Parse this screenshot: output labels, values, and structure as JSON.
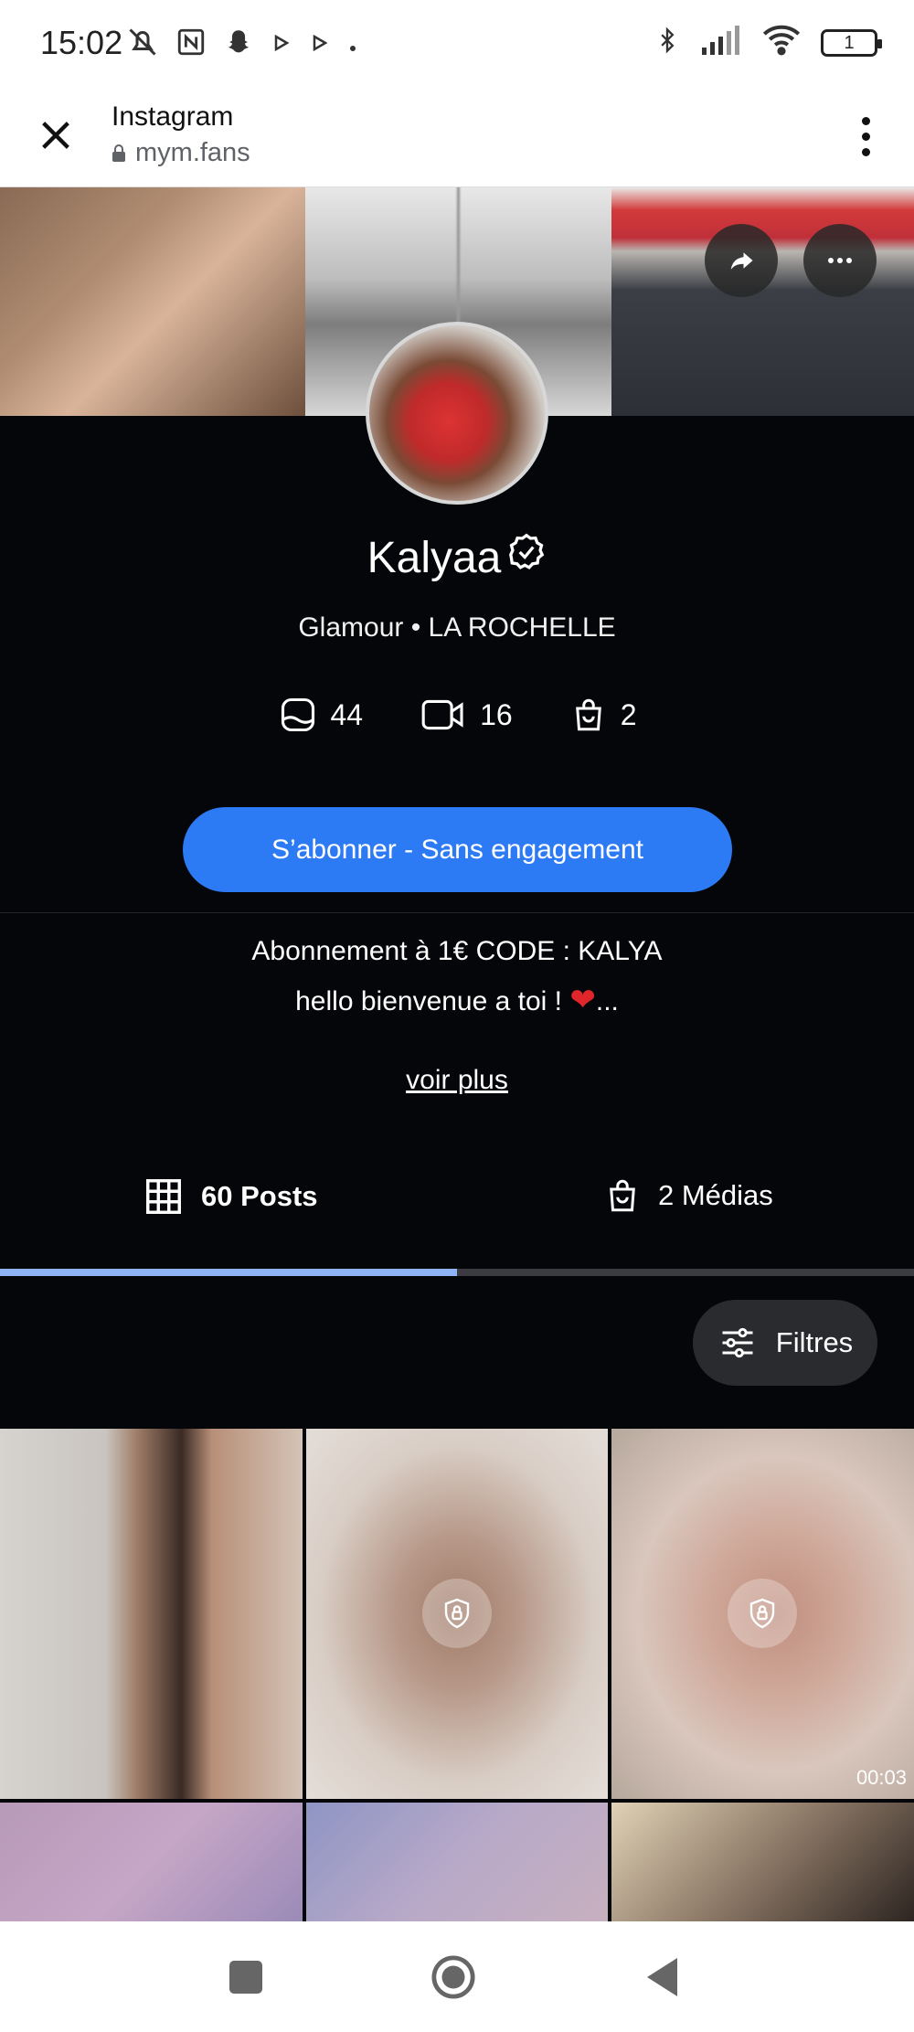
{
  "status_bar": {
    "time": "15:02",
    "battery": "1",
    "icons": [
      "mute-icon",
      "nfc-icon",
      "snapchat-icon",
      "play-icon",
      "play-icon",
      "dot-icon",
      "bluetooth-icon",
      "signal-icon",
      "wifi-icon"
    ]
  },
  "browser": {
    "title": "Instagram",
    "url": "mym.fans"
  },
  "profile": {
    "name": "Kalyaa",
    "subtitle": "Glamour • LA ROCHELLE",
    "stats": {
      "photos": "44",
      "videos": "16",
      "shop": "2"
    },
    "subscribe_label": "S’abonner - Sans engagement",
    "bio_line1": "Abonnement à 1€ CODE : KALYA",
    "bio_line2": "hello bienvenue a toi !",
    "bio_heart": "❤",
    "bio_ellipsis": "...",
    "more_label": "voir plus"
  },
  "tabs": {
    "posts_label": "60 Posts",
    "medias_label": "2 Médias",
    "active": "posts"
  },
  "filters_label": "Filtres",
  "grid": {
    "video_duration": "00:03"
  },
  "colors": {
    "accent": "#2c7bf5",
    "background": "#05060a",
    "tab_indicator": "#8fb3f5"
  }
}
